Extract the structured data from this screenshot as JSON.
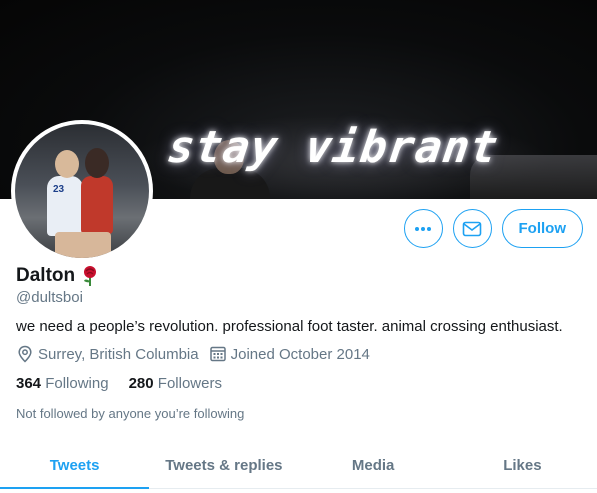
{
  "banner": {
    "neon_text": "stay vibrant"
  },
  "actions": {
    "more_label": "•••",
    "follow_label": "Follow"
  },
  "profile": {
    "name": "Dalton",
    "emoji": "🌹",
    "handle": "@dultsboi",
    "bio": "we need a people’s revolution. professional foot taster. animal crossing enthusiast.",
    "location": "Surrey, British Columbia",
    "joined": "Joined October 2014",
    "following_count": "364",
    "following_label": "Following",
    "followers_count": "280",
    "followers_label": "Followers",
    "not_followed_text": "Not followed by anyone you’re following"
  },
  "tabs": [
    {
      "label": "Tweets",
      "active": true
    },
    {
      "label": "Tweets & replies",
      "active": false
    },
    {
      "label": "Media",
      "active": false
    },
    {
      "label": "Likes",
      "active": false
    }
  ],
  "colors": {
    "accent": "#1da1f2",
    "text": "#14171a",
    "muted": "#657786"
  },
  "icons": [
    "more-icon",
    "mail-icon",
    "location-icon",
    "calendar-icon",
    "rose-emoji"
  ]
}
